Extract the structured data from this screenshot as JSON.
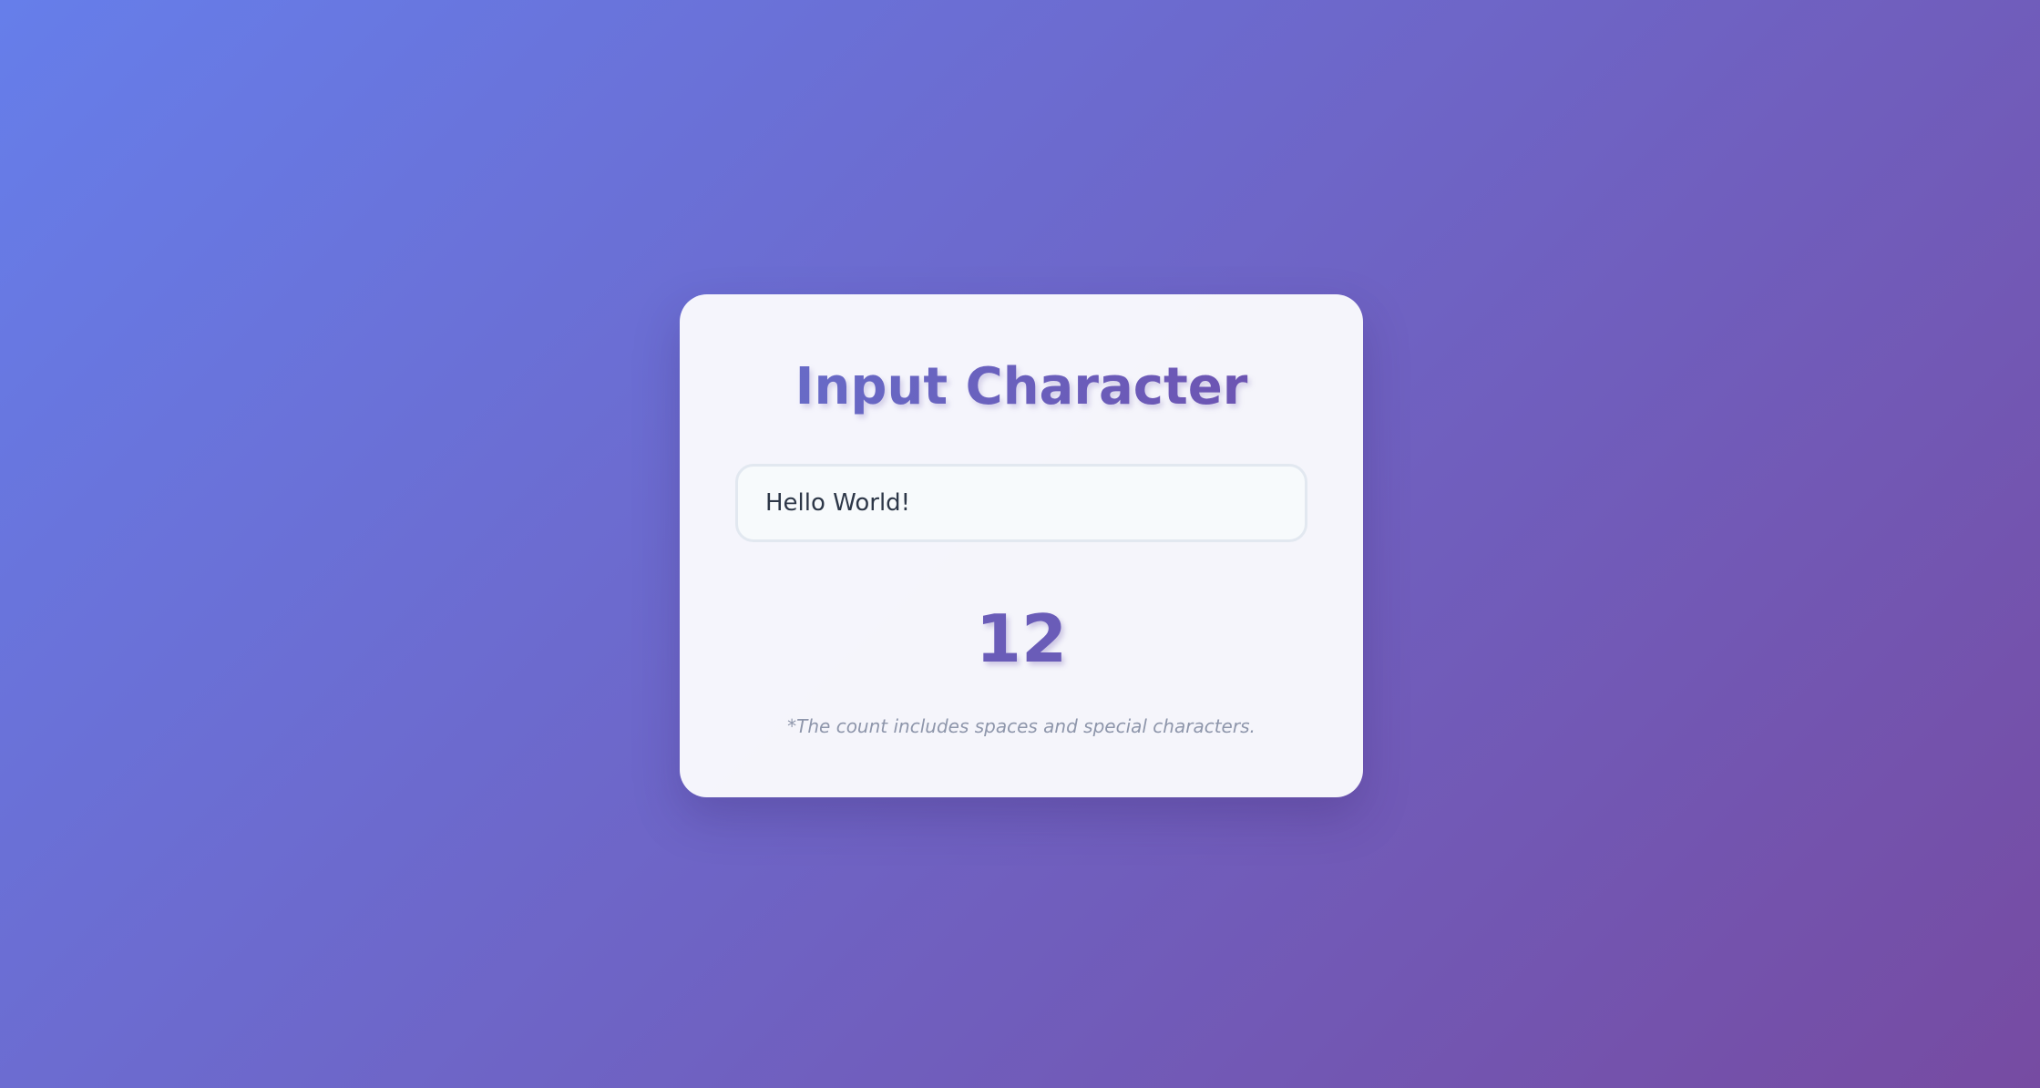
{
  "app": {
    "title": "Input Character",
    "input": {
      "value": "Hello World!",
      "placeholder": ""
    },
    "count": "12",
    "note": "*The count includes spaces and special characters."
  },
  "colors": {
    "background_start": "#667eea",
    "background_end": "#764ba2",
    "accent": "#6a5cb8",
    "card": "#fafafd",
    "input_border": "#e2e8f0",
    "note_text": "#8e96ab"
  }
}
